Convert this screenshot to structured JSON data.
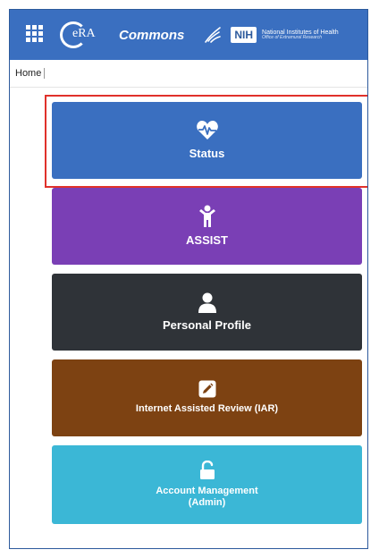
{
  "header": {
    "era_text": "eRA",
    "app_name": "Commons",
    "nih_badge": "NIH",
    "nih_line1": "National Institutes of Health",
    "nih_line2": "Office of Extramural Research"
  },
  "breadcrumb": {
    "home": "Home"
  },
  "tiles": [
    {
      "label": "Status",
      "color": "#3a6fc0",
      "icon": "heartbeat-icon"
    },
    {
      "label": "ASSIST",
      "color": "#7a3fb5",
      "icon": "person-icon"
    },
    {
      "label": "Personal Profile",
      "color": "#2f3338",
      "icon": "user-icon"
    },
    {
      "label": "Internet Assisted Review (IAR)",
      "color": "#7d4212",
      "icon": "edit-icon"
    },
    {
      "label": "Account Management\n(Admin)",
      "label_line1": "Account Management",
      "label_line2": "(Admin)",
      "color": "#3bb7d6",
      "icon": "unlock-icon"
    }
  ],
  "colors": {
    "header_bg": "#3a6fc0",
    "highlight": "#e0312b",
    "frame_border": "#2d5a9c"
  }
}
